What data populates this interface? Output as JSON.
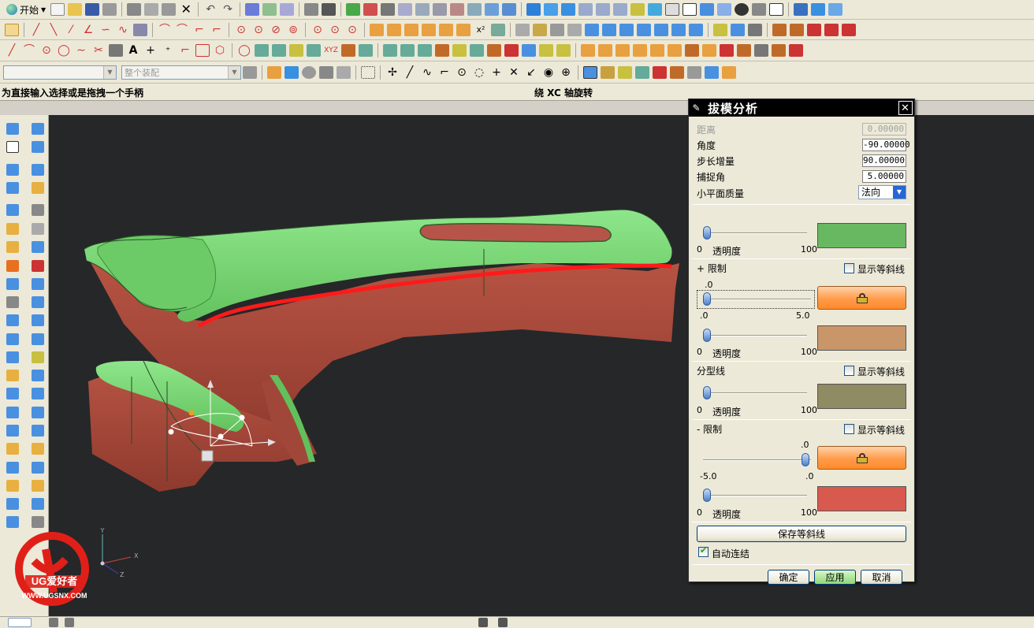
{
  "menubar": {
    "start_label": "开始"
  },
  "selection_bar": {
    "type_filter_value": "",
    "scope_value": "整个装配"
  },
  "status": {
    "prompt": "为直接输入选择或是拖拽一个手柄",
    "info": "绕 XC 轴旋转"
  },
  "dialog": {
    "title": "拔模分析",
    "distance": {
      "label": "距离",
      "value": "0.00000"
    },
    "angle": {
      "label": "角度",
      "value": "-90.00000"
    },
    "step": {
      "label": "步长增量",
      "value": "90.00000"
    },
    "snap": {
      "label": "捕捉角",
      "value": "5.00000"
    },
    "facet_quality": {
      "label": "小平面质量",
      "value": "法向"
    },
    "transparency_label": "透明度",
    "range_min": "0",
    "range_max": "100",
    "section_pos_limit": {
      "label": "+ 限制",
      "show_isoclines": "显示等斜线",
      "top_value": ".0",
      "min": ".0",
      "max": "5.0"
    },
    "section_parting": {
      "label": "分型线",
      "show_isoclines": "显示等斜线"
    },
    "section_neg_limit": {
      "label": "- 限制",
      "show_isoclines": "显示等斜线",
      "top_value": ".0",
      "min": "-5.0",
      "max": ".0"
    },
    "swatch_colors": {
      "positive": "#68b862",
      "pos_limit": "#c9966a",
      "parting": "#8f8b62",
      "negative": "#d85a4e"
    },
    "save_isoclines": "保存等斜线",
    "auto_update": {
      "label": "自动连结",
      "checked": true
    },
    "ok": "确定",
    "apply": "应用",
    "cancel": "取消"
  },
  "logo": {
    "text": "UG爱好者",
    "url": "WWW.UGSNX.COM"
  },
  "triad": {
    "x": "X",
    "y": "Y",
    "z": "Z"
  },
  "colors": {
    "viewport_bg": "#262729",
    "draft_positive": "#7fd67a",
    "draft_negative": "#b5503f",
    "parting_line": "#ff1a1a"
  }
}
